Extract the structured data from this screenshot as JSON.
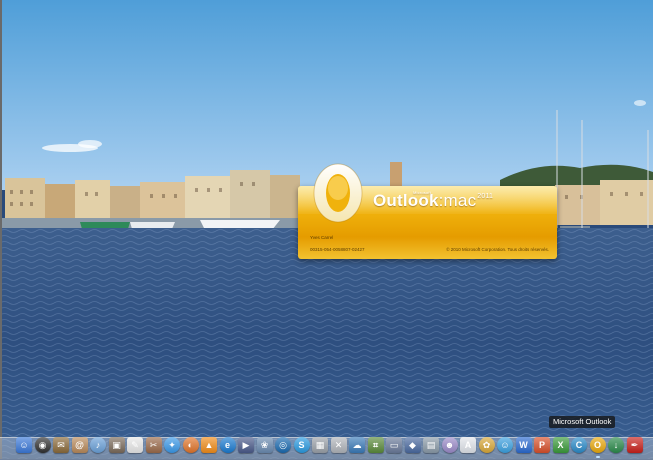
{
  "splash": {
    "microsoft_small": "Microsoft",
    "brand_name": "Outlook",
    "brand_suffix": ":mac",
    "brand_year": "2011",
    "user_name": "Yves Carrel",
    "serial": "00315-054-0058807-02427",
    "copyright": "© 2010 Microsoft Corporation. Tous droits réservés.",
    "logo_letter": "O",
    "colors": {
      "gold": "#f0b20c",
      "gold_light": "#f8d44a"
    }
  },
  "dock": {
    "tooltip": "Microsoft Outlook",
    "icons": [
      {
        "name": "finder-icon",
        "color": "#3a78d8",
        "glyph": "☺",
        "shape": "square"
      },
      {
        "name": "dashboard-icon",
        "color": "#303030",
        "glyph": "◉",
        "shape": "round"
      },
      {
        "name": "mail-icon",
        "color": "#8a6a3a",
        "glyph": "✉",
        "shape": "square"
      },
      {
        "name": "address-book-icon",
        "color": "#b8895a",
        "glyph": "@",
        "shape": "square"
      },
      {
        "name": "itunes-icon",
        "color": "#6aa0d8",
        "glyph": "♪",
        "shape": "round"
      },
      {
        "name": "preview-icon",
        "color": "#7a6a5a",
        "glyph": "▣",
        "shape": "square"
      },
      {
        "name": "textedit-icon",
        "color": "#e8e8e8",
        "glyph": "✎",
        "shape": "square"
      },
      {
        "name": "script-editor-icon",
        "color": "#9a6a4a",
        "glyph": "✂",
        "shape": "square"
      },
      {
        "name": "safari-icon",
        "color": "#3a98e8",
        "glyph": "✦",
        "shape": "round"
      },
      {
        "name": "firefox-icon",
        "color": "#e0742a",
        "glyph": "◐",
        "shape": "round"
      },
      {
        "name": "vlc-icon",
        "color": "#f08c1a",
        "glyph": "▲",
        "shape": "square"
      },
      {
        "name": "system-prefs-icon",
        "color": "#1a7ad0",
        "glyph": "e",
        "shape": "round"
      },
      {
        "name": "imovie-icon",
        "color": "#4a5a8a",
        "glyph": "▶",
        "shape": "square"
      },
      {
        "name": "iphoto-icon",
        "color": "#6a8ab0",
        "glyph": "❀",
        "shape": "square"
      },
      {
        "name": "ical-icon",
        "color": "#1a6ab0",
        "glyph": "◎",
        "shape": "round"
      },
      {
        "name": "skype-icon",
        "color": "#2a9ae0",
        "glyph": "S",
        "shape": "round"
      },
      {
        "name": "photo-booth-icon",
        "color": "#9aa0a8",
        "glyph": "▦",
        "shape": "square"
      },
      {
        "name": "utilities-icon",
        "color": "#b0b4ba",
        "glyph": "✕",
        "shape": "square"
      },
      {
        "name": "network-icon",
        "color": "#3a7ab8",
        "glyph": "☁",
        "shape": "square"
      },
      {
        "name": "calculator-icon",
        "color": "#5a8a3a",
        "glyph": "⌗",
        "shape": "square"
      },
      {
        "name": "display-icon",
        "color": "#6a7a9a",
        "glyph": "▭",
        "shape": "square"
      },
      {
        "name": "virtualbox-icon",
        "color": "#4a6aa0",
        "glyph": "◆",
        "shape": "square"
      },
      {
        "name": "activity-monitor-icon",
        "color": "#8a9aa8",
        "glyph": "▤",
        "shape": "square"
      },
      {
        "name": "chat-icon",
        "color": "#9a8ac8",
        "glyph": "☻",
        "shape": "round"
      },
      {
        "name": "font-book-icon",
        "color": "#e0e4ea",
        "glyph": "A",
        "shape": "square"
      },
      {
        "name": "colorsync-icon",
        "color": "#d8a838",
        "glyph": "✿",
        "shape": "round"
      },
      {
        "name": "messenger-icon",
        "color": "#3aa0e0",
        "glyph": "☺",
        "shape": "round"
      },
      {
        "name": "word-icon",
        "color": "#2a6ad0",
        "glyph": "W",
        "shape": "square"
      },
      {
        "name": "powerpoint-icon",
        "color": "#d8502a",
        "glyph": "P",
        "shape": "square"
      },
      {
        "name": "excel-icon",
        "color": "#3a9a3a",
        "glyph": "X",
        "shape": "square"
      },
      {
        "name": "communicator-icon",
        "color": "#2a8ac8",
        "glyph": "C",
        "shape": "round"
      },
      {
        "name": "outlook-icon",
        "color": "#e8a80c",
        "glyph": "O",
        "shape": "round",
        "running": true
      },
      {
        "name": "downloads-icon",
        "color": "#2a8a4a",
        "glyph": "↓",
        "shape": "round"
      },
      {
        "name": "acrobat-icon",
        "color": "#c8201a",
        "glyph": "✒",
        "shape": "square"
      }
    ]
  }
}
